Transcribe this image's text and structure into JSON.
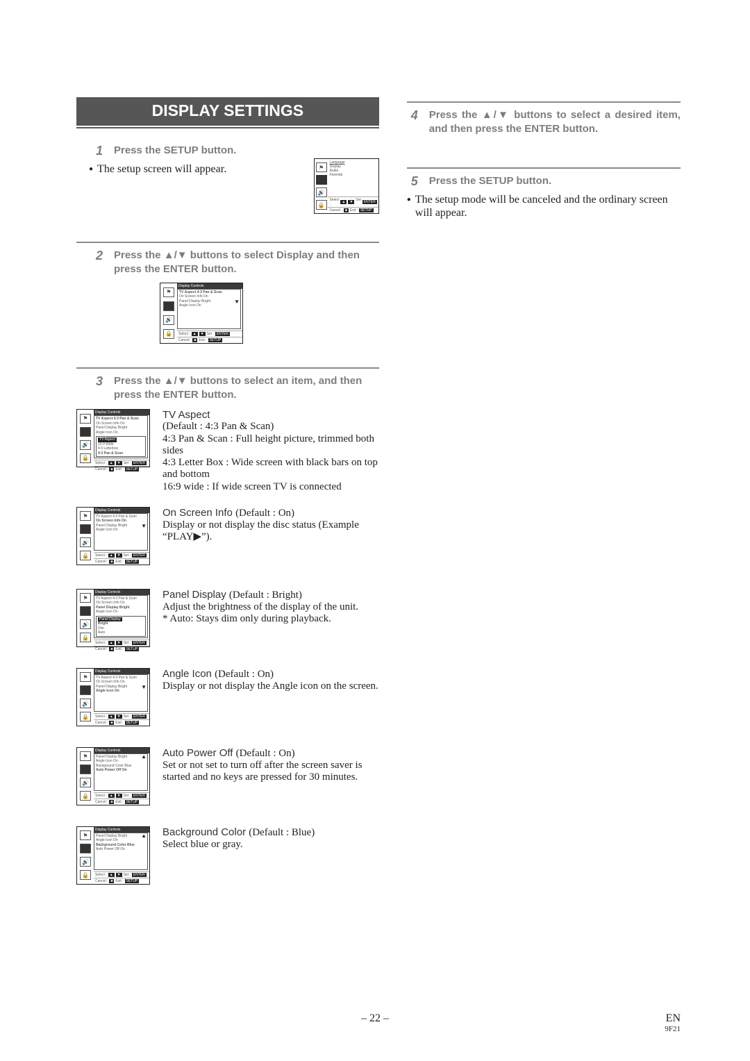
{
  "title": "DISPLAY SETTINGS",
  "col_left": {
    "step1": {
      "num": "1",
      "text": "Press the SETUP button.",
      "bullet": "The setup screen will appear."
    },
    "step2": {
      "num": "2",
      "text_a": "Press the ",
      "text_b": " buttons to select Display and then press the ENTER button."
    },
    "step3": {
      "num": "3",
      "text_a": "Press the ",
      "text_b": " buttons to select an item, and then press the ENTER button."
    },
    "tv_aspect": {
      "heading": "TV Aspect",
      "l1": "(Default : 4:3 Pan & Scan)",
      "l2": "4:3 Pan & Scan : Full height picture, trimmed both sides",
      "l3": "4:3 Letter Box : Wide screen with black bars on top and bottom",
      "l4": "16:9 wide : If wide screen TV is connected"
    },
    "on_screen": {
      "heading": "On Screen Info ",
      "def": "(Default : On)",
      "l1": "Display or not display the disc status (Example “PLAY▶”)."
    },
    "panel_display": {
      "heading": "Panel Display ",
      "def": "(Default : Bright)",
      "l1": "Adjust the brightness of the display of the unit.",
      "l2": "* Auto: Stays dim only during playback."
    },
    "angle_icon": {
      "heading": "Angle Icon ",
      "def": "(Default : On)",
      "l1": "Display or not display the Angle icon on the screen."
    },
    "auto_power": {
      "heading": "Auto Power Off ",
      "def": "(Default : On)",
      "l1": "Set or not set to turn off after the screen saver is started and no keys are pressed for 30 minutes."
    },
    "bg_color": {
      "heading": "Background Color ",
      "def": "(Default : Blue)",
      "l1": "Select blue or gray."
    },
    "osd_common": {
      "panel_title": "Display Controls",
      "rows": {
        "r1": "TV Aspect       4:3 Pan & Scan",
        "r2": "On Screen Info  On",
        "r3": "Panel Display   Bright",
        "r4": "Angle Icon      On"
      },
      "sub_tv": {
        "a": "16:9 Wide",
        "b": "4:3 Letterbox",
        "c": "4:3 Pan & Scan"
      },
      "sub_pd": {
        "a": "Bright",
        "b": "Dim",
        "c": "Auto"
      },
      "lower": {
        "r1": "Panel Display   Bright",
        "r2": "Angle Icon      On",
        "r3": "Background Color Blue",
        "r4": "Auto Power Off  On"
      },
      "foot_select": "Select :",
      "foot_set": "Set :",
      "foot_enter": "ENTER",
      "foot_cancel": "Cancel :",
      "foot_exit": "Exit :",
      "foot_setup": "SETUP",
      "foot_stop": "■"
    },
    "menu_labels": {
      "a": "Language",
      "b": "Display",
      "c": "Audio",
      "d": "Parental"
    }
  },
  "col_right": {
    "step4": {
      "num": "4",
      "text_a": "Press the ",
      "text_b": " buttons to select a desired item, and then press the ENTER button."
    },
    "step5": {
      "num": "5",
      "text": "Press the SETUP button.",
      "bullet": "The setup mode will be canceled and the ordinary screen will appear."
    }
  },
  "footer": {
    "page": "– 22 –",
    "lang": "EN",
    "code": "9F21"
  },
  "glyphs": {
    "up": "▲",
    "down": "▼",
    "play": "▶"
  }
}
